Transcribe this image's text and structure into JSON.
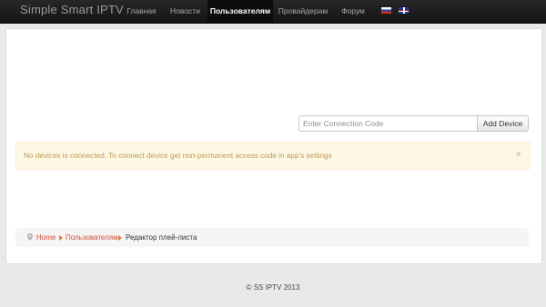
{
  "navbar": {
    "brand": "Simple Smart IPTV",
    "items": [
      {
        "label": "Главная"
      },
      {
        "label": "Новости"
      },
      {
        "label": "Пользователям"
      },
      {
        "label": "Провайдерам"
      },
      {
        "label": "Форум"
      }
    ],
    "languages": [
      "ru-flag-icon",
      "uk-flag-icon"
    ]
  },
  "device": {
    "input_placeholder": "Enter Connection Code",
    "input_value": "",
    "add_label": "Add Device"
  },
  "alert": {
    "text": "No devices is connected. To connect device get non-permanent access code in app's settings",
    "close": "×"
  },
  "breadcrumb": {
    "icon": "map-pin-icon",
    "items": [
      {
        "label": "Home"
      },
      {
        "label": "Пользователям"
      },
      {
        "label": "Редактор плей-листа"
      }
    ]
  },
  "footer": {
    "text": "© SS IPTV 2013"
  },
  "colors": {
    "navbar": "#1b1b1b",
    "alert_bg": "#fcf8e3",
    "alert_text": "#c09853",
    "link": "#d24e36",
    "separator": "#e07a36"
  }
}
